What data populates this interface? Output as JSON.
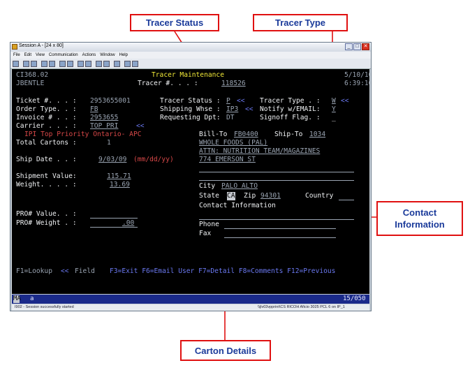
{
  "callouts": {
    "tracer_status": "Tracer Status",
    "tracer_type": "Tracer Type",
    "contact_info": "Contact\nInformation",
    "carton_details": "Carton Details"
  },
  "window": {
    "title": "Session A - [24 x 80]",
    "menu": [
      "File",
      "Edit",
      "View",
      "Communication",
      "Actions",
      "Window",
      "Help"
    ]
  },
  "screen": {
    "program": "CI368.02",
    "user": "JBENTLE",
    "title": "Tracer Maintenance",
    "date": "5/10/10",
    "time": "6:39:16",
    "tracer_no_label": "Tracer #. . . :",
    "tracer_no": "118526",
    "ticket_label": "Ticket #. . . :",
    "ticket": "2953655001",
    "tracer_status_label": "Tracer Status :",
    "tracer_status": "P",
    "prompt": "<<",
    "tracer_type_label": "Tracer Type . :",
    "tracer_type": "W",
    "order_type_label": "Order Type. . :",
    "order_type": "FB",
    "ship_whse_label": "Shipping Whse :",
    "ship_whse": "IP3",
    "notify_label": "Notify w/EMAIL:",
    "notify": "Y",
    "invoice_label": "Invoice # . . :",
    "invoice": "2953655",
    "req_dpt_label": "Requesting Dpt:",
    "req_dpt": "DT",
    "signoff_label": "Signoff Flag. :",
    "signoff": "_",
    "carrier_label": "Carrier . . . :",
    "carrier": "TOP PRI",
    "carrier_desc": "IPI Top Priority Ontario- APC",
    "bill_to_label": "Bill-To",
    "bill_to": "FB0400",
    "ship_to_label": "Ship-To",
    "ship_to": "1034",
    "total_cartons_label": "Total Cartons :",
    "total_cartons": "1",
    "addr1": "WHOLE FOODS (PAL)",
    "addr2": "ATTN: NUTRITION TEAM/MAGAZINES",
    "ship_date_label": "Ship Date . . :",
    "ship_date": "9/03/09",
    "ship_date_fmt": "(mm/dd/yy)",
    "addr3": "774 EMERSON ST",
    "shipment_value_label": "Shipment Value:",
    "shipment_value": "115.71",
    "weight_label": "Weight. . . . :",
    "weight": "13.69",
    "city_label": "City",
    "city": "PALO ALTO",
    "state_label": "State",
    "state": "CA",
    "zip_label": "Zip",
    "zip": "94301",
    "country_label": "Country",
    "contact_label": "Contact Information",
    "pro_value_label": "PRO# Value. . :",
    "pro_weight_label": "PRO# Weight . :",
    "pro_weight": ".00",
    "phone_label": "Phone",
    "fax_label": "Fax",
    "fkeys_lookup": "F1=Lookup",
    "fkeys_field": "Field",
    "fkeys_rest": "F3=Exit F6=Email User F7=Detail F8=Comments F12=Previous"
  },
  "oia": {
    "mode": "MA",
    "indicator": "a",
    "position": "15/050"
  },
  "statusbar": {
    "message": "I902 - Session successfully started",
    "printer": "\\\\jlv03vpprint\\CS RICOH Aficio 3025 PCL 6 on IP_1"
  },
  "colors": {
    "callout_border": "#e01010",
    "callout_text": "#1a3a9a",
    "terminal_bg": "#000000"
  }
}
